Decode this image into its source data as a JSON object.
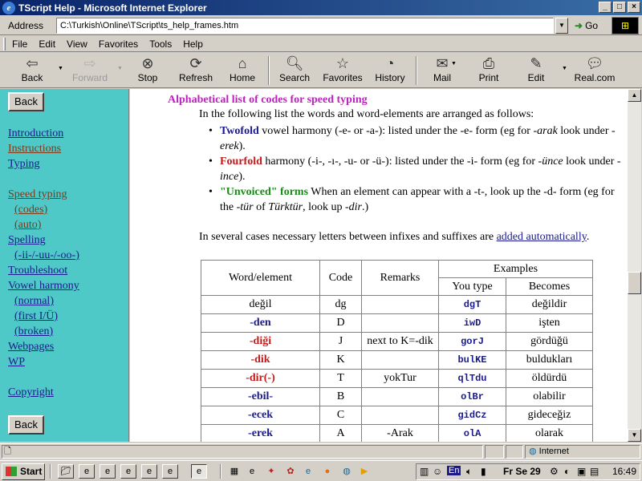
{
  "window": {
    "title": "TScript Help - Microsoft Internet Explorer",
    "controls": [
      "_",
      "□",
      "×"
    ]
  },
  "address": {
    "label": "Address",
    "url": "C:\\Turkish\\Online\\TScript\\ts_help_frames.htm",
    "go_label": "Go"
  },
  "menu": [
    "File",
    "Edit",
    "View",
    "Favorites",
    "Tools",
    "Help"
  ],
  "toolbar": {
    "back": "Back",
    "forward": "Forward",
    "stop": "Stop",
    "refresh": "Refresh",
    "home": "Home",
    "search": "Search",
    "favorites": "Favorites",
    "history": "History",
    "mail": "Mail",
    "print": "Print",
    "edit": "Edit",
    "real": "Real.com"
  },
  "sidebar": {
    "back_top": "Back",
    "back_bottom": "Back",
    "links": [
      "Introduction",
      "Instructions",
      "Typing",
      "Speed typing",
      "(codes)",
      "(auto)",
      "Spelling",
      "(-ii-/-uu-/-oo-)",
      "Troubleshoot",
      "Vowel harmony",
      "(normal)",
      "(first I/Ü)",
      "(broken)",
      "Webpages",
      "WP",
      "Copyright"
    ]
  },
  "content": {
    "heading": "Alphabetical list of codes for speed typing",
    "intro": "In the following list the words and word-elements are arranged as follows:",
    "bullets": [
      {
        "key": "Twofold",
        "pre": " vowel harmony (-e- or -a-): listed under the -e- form (eg for ",
        "i1": "-arak",
        "mid": " look under ",
        "i2": "-erek",
        "post": ")."
      },
      {
        "key": "Fourfold",
        "pre": " harmony (-i-, -ı-, -u- or -ü-): listed under the -i- form (eg for ",
        "i1": "-ünce",
        "mid": " look under ",
        "i2": "-ince",
        "post": ")."
      },
      {
        "key": "\"Unvoiced\" forms",
        "pre": " When an element can appear with a -t-, look up the -d- form (eg for the ",
        "i1": "-tür",
        "mid": " of ",
        "i2": "Türktür",
        "mid2": ", look up ",
        "i3": "-dir",
        "post": ".)"
      }
    ],
    "para2_pre": "In several cases necessary letters between infixes and suffixes are ",
    "para2_link": "added automatically",
    "para2_post": "."
  },
  "table": {
    "headers": {
      "word": "Word/element",
      "code": "Code",
      "remarks": "Remarks",
      "examples": "Examples",
      "you_type": "You type",
      "becomes": "Becomes"
    },
    "rows": [
      {
        "word": "değil",
        "style": "plain",
        "code": "dg",
        "remarks": "",
        "type": "dgT",
        "becomes": "değildir"
      },
      {
        "word": "-den",
        "style": "blue",
        "code": "D",
        "remarks": "",
        "type": "iwD",
        "becomes": "işten"
      },
      {
        "word": "-diği",
        "style": "red",
        "code": "J",
        "remarks": "next to K=-dik",
        "type": "gorJ",
        "becomes": "gördüğü"
      },
      {
        "word": "-dik",
        "style": "red",
        "code": "K",
        "remarks": "",
        "type": "bulKE",
        "becomes": "buldukları"
      },
      {
        "word": "-dir(-)",
        "style": "red",
        "code": "T",
        "remarks": "yokTur",
        "type": "qlTdu",
        "becomes": "öldürdü"
      },
      {
        "word": "-ebil-",
        "style": "blue",
        "code": "B",
        "remarks": "",
        "type": "olBr",
        "becomes": "olabilir"
      },
      {
        "word": "-ecek",
        "style": "blue",
        "code": "C",
        "remarks": "",
        "type": "gidCz",
        "becomes": "gideceğiz"
      },
      {
        "word": "-erek",
        "style": "blue",
        "code": "A",
        "remarks": "-Arak",
        "type": "olA",
        "becomes": "olarak"
      }
    ]
  },
  "status": {
    "zone": "Internet"
  },
  "taskbar": {
    "start": "Start",
    "lang": "En",
    "tray_text": "Fr Se 29",
    "clock": "16:49"
  }
}
